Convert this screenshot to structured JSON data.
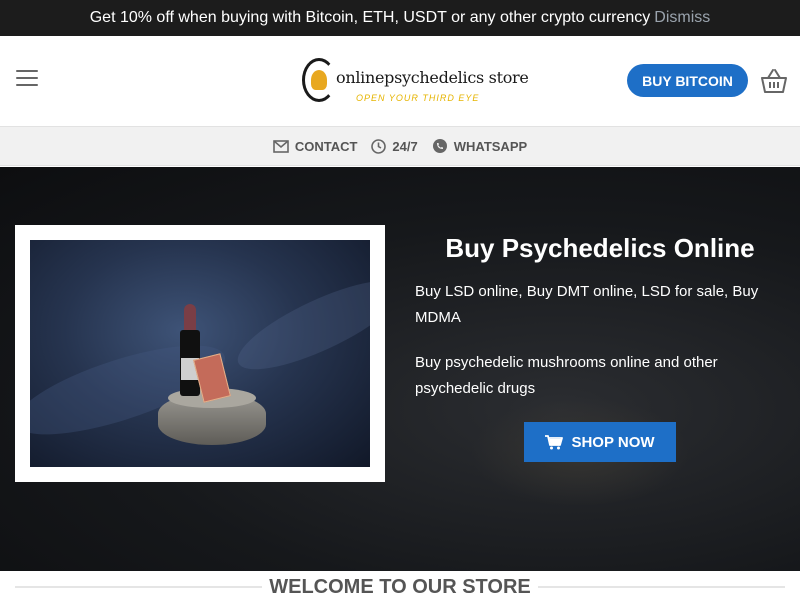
{
  "notice": {
    "message": "Get 10% off when buying with Bitcoin, ETH, USDT or any other crypto currency",
    "dismiss_label": "Dismiss"
  },
  "header": {
    "logo_name": "onlinepsychedelics store",
    "logo_tagline": "OPEN YOUR THIRD EYE",
    "buy_button": "BUY BITCOIN",
    "menu_icon": "hamburger-menu-icon",
    "cart_icon": "shopping-basket-icon"
  },
  "contact_bar": {
    "items": [
      {
        "icon": "envelope-icon",
        "label": "CONTACT"
      },
      {
        "icon": "clock-icon",
        "label": "24/7"
      },
      {
        "icon": "whatsapp-icon",
        "label": "WHATSAPP"
      }
    ]
  },
  "hero": {
    "title": "Buy Psychedelics Online",
    "paragraph1": "Buy LSD online, Buy DMT online, LSD for sale, Buy MDMA",
    "paragraph2": "Buy psychedelic mushrooms online  and other psychedelic drugs",
    "cta_label": "SHOP NOW",
    "cta_icon": "cart-icon"
  },
  "welcome": {
    "heading": "WELCOME TO OUR STORE"
  },
  "colors": {
    "accent": "#1e6fc7",
    "notice_bg": "#1c1c1c",
    "hero_bg": "#16181b",
    "tagline": "#e6b400"
  }
}
